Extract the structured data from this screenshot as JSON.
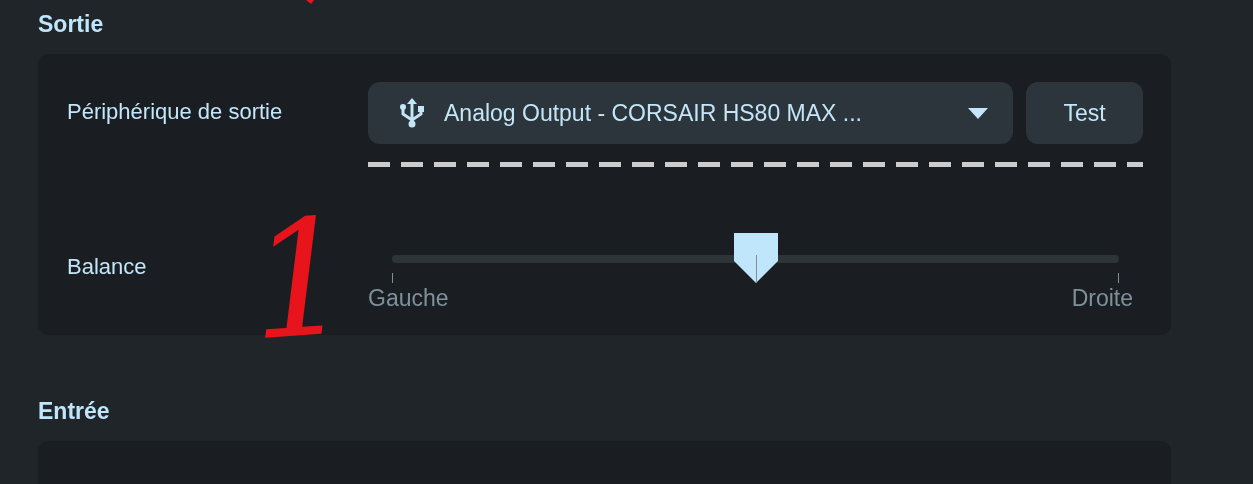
{
  "sections": [
    {
      "title": "Sortie",
      "rows": [
        {
          "kind": "device",
          "label": "Périphérique de sortie",
          "device": "Analog Output - CORSAIR HS80 MAX ...",
          "button": "Test",
          "focused": true
        },
        {
          "kind": "slider",
          "label": "Balance",
          "level": 0.5,
          "min_label": "Gauche",
          "max_label": "Droite"
        }
      ]
    },
    {
      "title": "Entrée"
    }
  ],
  "annotation": {
    "text": "1"
  }
}
